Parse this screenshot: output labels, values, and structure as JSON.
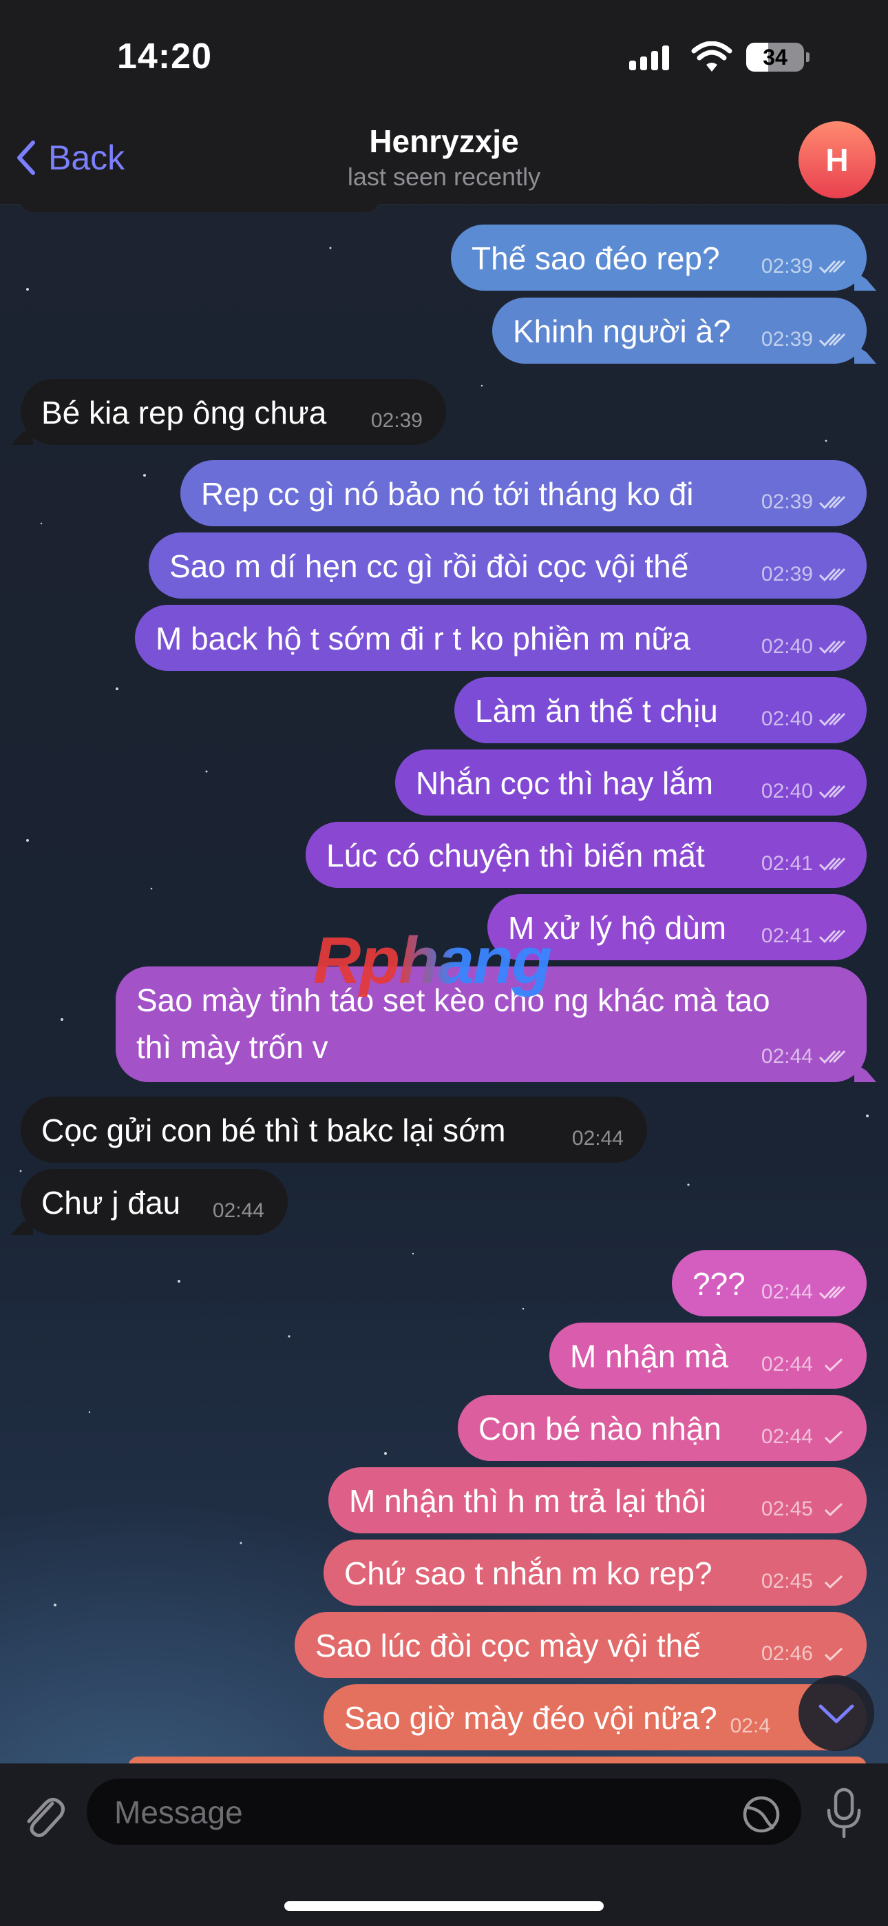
{
  "status_bar": {
    "time": "14:20",
    "battery": "34"
  },
  "header": {
    "back_label": "Back",
    "title": "Henryzxje",
    "subtitle": "last seen recently",
    "avatar_letter": "H"
  },
  "messages": [
    {
      "dir": "out",
      "text": "Thế sao đéo rep?",
      "time": "02:39",
      "status": "read"
    },
    {
      "dir": "out",
      "text": "Khinh người à?",
      "time": "02:39",
      "status": "read"
    },
    {
      "dir": "in",
      "text": "Bé kia rep ông chưa",
      "time": "02:39"
    },
    {
      "dir": "out",
      "text": "Rep cc gì nó bảo nó tới tháng ko đi",
      "time": "02:39",
      "status": "read"
    },
    {
      "dir": "out",
      "text": "Sao m dí hẹn cc gì rồi đòi cọc vội thế",
      "time": "02:39",
      "status": "read"
    },
    {
      "dir": "out",
      "text": "M back hộ t sớm đi r t ko phiền m nữa",
      "time": "02:40",
      "status": "read"
    },
    {
      "dir": "out",
      "text": "Làm ăn thế t chịu",
      "time": "02:40",
      "status": "read"
    },
    {
      "dir": "out",
      "text": "Nhắn cọc thì hay lắm",
      "time": "02:40",
      "status": "read"
    },
    {
      "dir": "out",
      "text": "Lúc có chuyện thì biến mất",
      "time": "02:41",
      "status": "read"
    },
    {
      "dir": "out",
      "text": "M xử lý hộ dùm",
      "time": "02:41",
      "status": "read"
    },
    {
      "dir": "out",
      "text": "Sao mày tỉnh táo set kèo cho ng khác mà tao",
      "text2": "thì mày trốn v",
      "time": "02:44",
      "status": "read"
    },
    {
      "dir": "in",
      "text": "Cọc gửi con bé thì t bakc lại sớm",
      "time": "02:44"
    },
    {
      "dir": "in",
      "text": "Chư j đau",
      "time": "02:44"
    },
    {
      "dir": "out",
      "text": "???",
      "time": "02:44",
      "status": "read"
    },
    {
      "dir": "out",
      "text": "M nhận mà",
      "time": "02:44",
      "status": "sent"
    },
    {
      "dir": "out",
      "text": "Con bé nào nhận",
      "time": "02:44",
      "status": "sent"
    },
    {
      "dir": "out",
      "text": "M nhận thì h m trả lại thôi",
      "time": "02:45",
      "status": "sent"
    },
    {
      "dir": "out",
      "text": "Chứ sao t nhắn m ko rep?",
      "time": "02:45",
      "status": "sent"
    },
    {
      "dir": "out",
      "text": "Sao lúc đòi cọc mày vội thế",
      "time": "02:46",
      "status": "sent"
    },
    {
      "dir": "out",
      "text": "Sao giờ mày đéo vội nữa?",
      "time": "02:4",
      "status": "sent"
    }
  ],
  "watermark": "Rphang",
  "composer": {
    "placeholder": "Message"
  },
  "colors": {
    "accent": "#7c80ff",
    "incoming": "#1a1a1c",
    "outgoing_top": "#5b8ad0",
    "outgoing_mid": "#8a48d6",
    "outgoing_bottom": "#e3705c"
  }
}
